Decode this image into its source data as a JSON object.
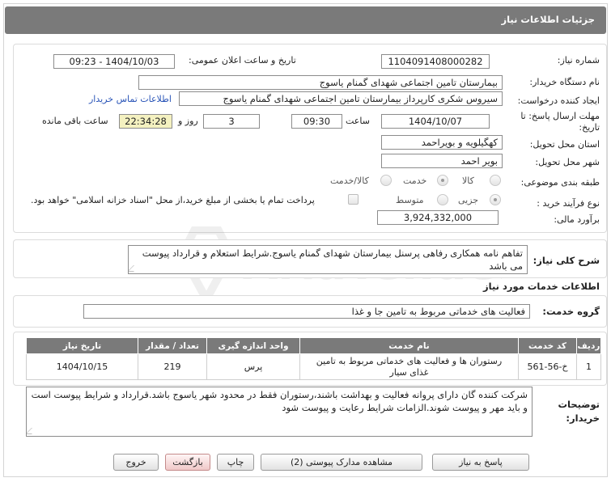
{
  "header": {
    "title": "جزئیات اطلاعات نیاز"
  },
  "need_number": {
    "label": "شماره نیاز:",
    "value": "1104091408000282"
  },
  "announce": {
    "label": "تاریخ و ساعت اعلان عمومی:",
    "value": "1404/10/03 - 09:23"
  },
  "buyer": {
    "label": "نام دستگاه خریدار:",
    "value": "بیمارستان تامین اجتماعی شهدای گمنام یاسوج"
  },
  "creator": {
    "label": "ایجاد کننده درخواست:",
    "value": "سیروس شکری کارپرداز بیمارستان تامین اجتماعی شهدای گمنام یاسوج",
    "contact_link": "اطلاعات تماس خریدار"
  },
  "deadline": {
    "label_line1": "مهلت ارسال پاسخ: تا",
    "label_line2": "تاریخ:",
    "date": "1404/10/07",
    "time_label": "ساعت",
    "time": "09:30",
    "days": "3",
    "days_label": "روز و",
    "remaining": "22:34:28",
    "remaining_label": "ساعت باقی مانده"
  },
  "province": {
    "label": "استان محل تحویل:",
    "value": "کهگیلویه و بویراحمد"
  },
  "city": {
    "label": "شهر محل تحویل:",
    "value": "بویر احمد"
  },
  "category": {
    "label": "طبقه بندی موضوعی:",
    "options": [
      "کالا",
      "خدمت",
      "کالا/خدمت"
    ],
    "selected": "خدمت"
  },
  "process": {
    "label": "نوع فرآیند خرید :",
    "options": [
      "جزیی",
      "متوسط"
    ],
    "selected": "جزیی",
    "payment_note": "پرداخت تمام یا بخشی از مبلغ خرید،از محل \"اسناد خزانه اسلامی\" خواهد بود."
  },
  "budget": {
    "label": "برآورد مالی:",
    "value": "3,924,332,000"
  },
  "description": {
    "label": "شرح کلی نیاز:",
    "value": "تفاهم نامه همکاری رفاهی پرسنل بیمارستان شهدای گمنام یاسوج.شرایط استعلام و قرارداد پیوست می باشد"
  },
  "services_info": {
    "title": "اطلاعات خدمات مورد نیاز"
  },
  "service_group": {
    "label": "گروه خدمت:",
    "value": "فعالیت های خدماتی مربوط به تامین جا و غذا"
  },
  "table": {
    "headers": [
      "ردیف",
      "کد خدمت",
      "نام خدمت",
      "واحد اندازه گیری",
      "تعداد / مقدار",
      "تاریخ نیاز"
    ],
    "rows": [
      [
        "1",
        "خ-56-561",
        "رستوران ها و فعالیت های خدماتی مربوط به تامین غذای سیار",
        "پرس",
        "219",
        "1404/10/15"
      ]
    ]
  },
  "buyer_notes": {
    "label_line1": "توضیحات",
    "label_line2": "خریدار:",
    "value": "شرکت کننده گان دارای پروانه فعالیت و بهداشت باشند،رستوران فقط در محدود شهر یاسوج باشد.قرارداد و شرایط پیوست است و باید مهر و پیوست شوند.الزامات شرایط رعایت و پیوست شود"
  },
  "buttons": {
    "reply": "پاسخ به نیاز",
    "attachments": "مشاهده مدارک پیوستی (2)",
    "print": "چاپ",
    "back": "بازگشت",
    "exit": "خروج"
  },
  "watermark": {
    "text": "AriaTender.net"
  },
  "colors": {
    "header_bg": "#7a7a7a",
    "link": "#2a55b8",
    "timer_bg": "#f4f1c0",
    "table_header_bg": "#7a7a7a"
  }
}
